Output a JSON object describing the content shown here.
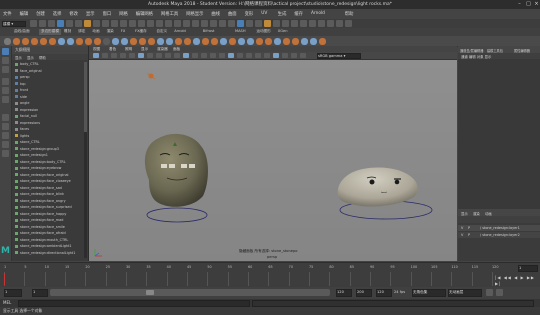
{
  "window": {
    "title": "Autodesk Maya 2018 - Student Version: H:\\网络课程资料\\actical project\\studio\\stone_redesign\\light rocks.ma*"
  },
  "menubar": {
    "items": [
      "文件",
      "编辑",
      "创建",
      "选择",
      "修改",
      "显示",
      "窗口",
      "网格",
      "编辑网格",
      "网格工具",
      "网格显示",
      "曲线",
      "曲面",
      "变形",
      "UV",
      "生成",
      "缓存",
      "Arnold",
      "帮助"
    ]
  },
  "statusline": {
    "mode": "建模"
  },
  "shelf": {
    "tabs": [
      "曲线/曲面",
      "多边形建模",
      "雕刻",
      "绑定",
      "动画",
      "渲染",
      "FX",
      "FX缓存",
      "自定义",
      "Arnold",
      "Bifrost",
      "MASH",
      "运动图形",
      "XGen"
    ],
    "active_tab": "多边形建模"
  },
  "outliner": {
    "header": "大纲视图",
    "menu": [
      "显示",
      "显示",
      "帮助"
    ],
    "items": [
      {
        "name": "body_CTRL"
      },
      {
        "name": "face_original"
      },
      {
        "name": "persp"
      },
      {
        "name": "top"
      },
      {
        "name": "front"
      },
      {
        "name": "side"
      },
      {
        "name": "angle"
      },
      {
        "name": "expression"
      },
      {
        "name": "facial_null"
      },
      {
        "name": "expressions"
      },
      {
        "name": "faces"
      },
      {
        "name": "lights"
      },
      {
        "name": "stone_CTRL"
      },
      {
        "name": "stone_redesign:group3"
      },
      {
        "name": "stone_redesign1"
      },
      {
        "name": "stone_redesign:body_CTRL"
      },
      {
        "name": "stone_redesign:eyebrow"
      },
      {
        "name": "stone_redesign:face_original"
      },
      {
        "name": "stone_redesign:face_closeeye"
      },
      {
        "name": "stone_redesign:face_sad"
      },
      {
        "name": "stone_redesign:face_blink"
      },
      {
        "name": "stone_redesign:face_angry"
      },
      {
        "name": "stone_redesign:face_surprised"
      },
      {
        "name": "stone_redesign:face_happy"
      },
      {
        "name": "stone_redesign:face_mad"
      },
      {
        "name": "stone_redesign:face_smile"
      },
      {
        "name": "stone_redesign:face_afraid"
      },
      {
        "name": "stone_redesign:mouth_CTRL"
      },
      {
        "name": "stone_redesign:ambientLight1"
      },
      {
        "name": "stone_redesign:directionalLight1"
      }
    ]
  },
  "viewport": {
    "menus": [
      "视图",
      "着色",
      "照明",
      "显示",
      "渲染器",
      "面板"
    ],
    "camera_label": "persp",
    "hud_line1": "隐藏面板 所有选择: stone_stonepo",
    "colorspace": "sRGB gamma"
  },
  "channelbox": {
    "tabs": [
      "通道盒/层编辑器",
      "建模工具包",
      "属性编辑器"
    ],
    "layer_menu": [
      "显示",
      "渲染",
      "动画"
    ],
    "layers": [
      {
        "v": "V",
        "p": "P",
        "name": "/ stone_redesign:layer1"
      },
      {
        "v": "V",
        "p": "P",
        "name": "/ stone_redesign:layer2"
      }
    ]
  },
  "timeline": {
    "ticks": [
      "1",
      "5",
      "10",
      "15",
      "20",
      "25",
      "30",
      "35",
      "40",
      "45",
      "50",
      "55",
      "60",
      "65",
      "70",
      "75",
      "80",
      "85",
      "90",
      "95",
      "100",
      "105",
      "110",
      "115",
      "120"
    ],
    "current_frame": "1"
  },
  "range": {
    "start": "1",
    "inner_start": "1",
    "inner_end": "120",
    "end": "200",
    "end2": "120",
    "char_set": "无角色集",
    "anim_layer": "无动画层",
    "fps": "24 fps"
  },
  "cmd": {
    "label": "MEL",
    "helpline": "显示工具 选择一个对象"
  },
  "colors": {
    "accent_blue": "#4a7fb5",
    "viewport_bg": "#8a8a8a",
    "rock_dark": "#6b6852",
    "rock_light": "#b7b2a4",
    "maya_logo": "#2fb3a8"
  }
}
